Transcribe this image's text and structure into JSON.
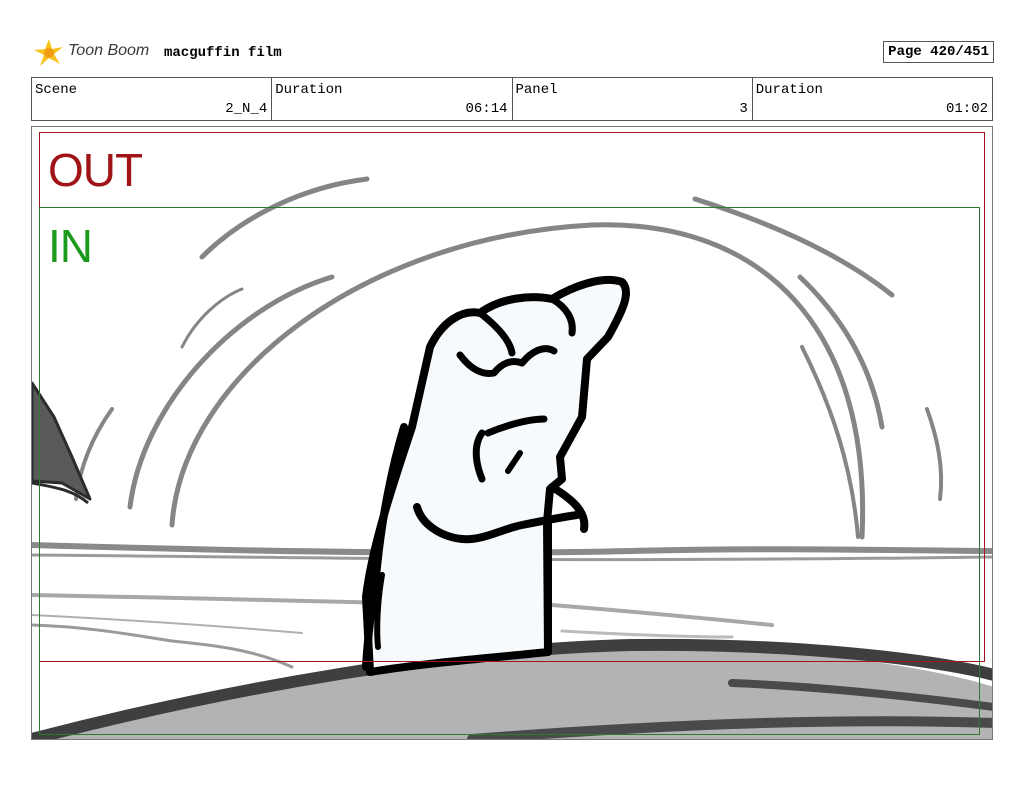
{
  "header": {
    "logo_text": "Toon Boom",
    "project_title": "macguffin film",
    "page_label": "Page 420/451"
  },
  "info": {
    "scene_label": "Scene",
    "scene_value": "2_N_4",
    "scene_duration_label": "Duration",
    "scene_duration_value": "06:14",
    "panel_label": "Panel",
    "panel_value": "3",
    "panel_duration_label": "Duration",
    "panel_duration_value": "01:02"
  },
  "panel": {
    "out_label": "OUT",
    "in_label": "IN",
    "colors": {
      "out_frame": "#a0181f",
      "in_frame": "#2f7a2f",
      "sketch_grey": "#808080",
      "ground_fill": "#b3b3b3",
      "figure_fill": "#f6fafd"
    }
  },
  "icons": {
    "logo_icon": "toon-boom-star-logo"
  }
}
